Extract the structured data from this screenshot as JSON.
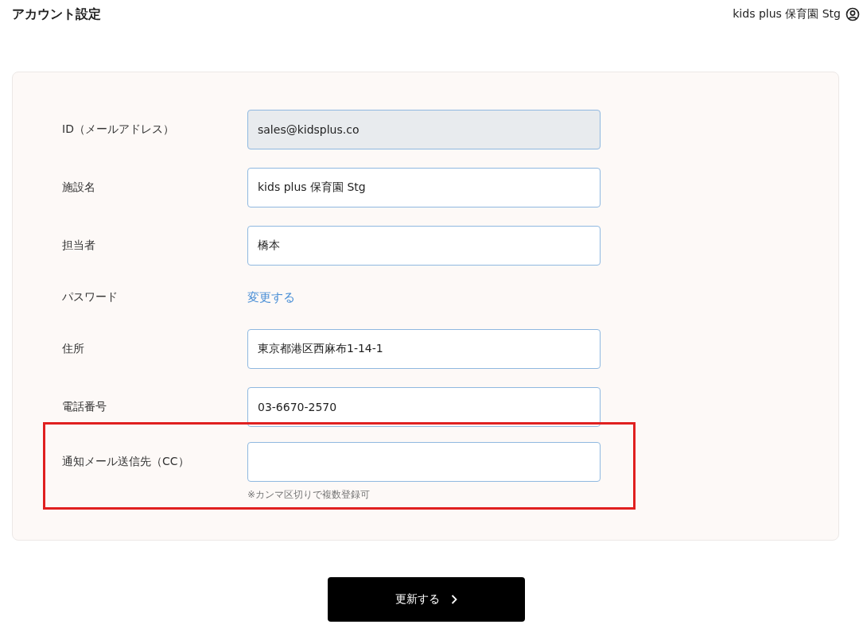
{
  "page_title": "アカウント設定",
  "user": {
    "name": "kids plus 保育園 Stg"
  },
  "form": {
    "rows": [
      {
        "kind": "input",
        "label": "ID（メールアドレス）",
        "value": "sales@kidsplus.co",
        "disabled": true,
        "highlighted": false
      },
      {
        "kind": "input",
        "label": "施設名",
        "value": "kids plus 保育園 Stg",
        "disabled": false,
        "highlighted": false
      },
      {
        "kind": "input",
        "label": "担当者",
        "value": "橋本",
        "disabled": false,
        "highlighted": false
      },
      {
        "kind": "link",
        "label": "パスワード",
        "link": "変更する",
        "highlighted": false
      },
      {
        "kind": "input",
        "label": "住所",
        "value": "東京都港区西麻布1-14-1",
        "disabled": false,
        "highlighted": false
      },
      {
        "kind": "input",
        "label": "電話番号",
        "value": "03-6670-2570",
        "disabled": false,
        "highlighted": false
      },
      {
        "kind": "input",
        "label": "通知メール送信先（CC）",
        "value": "",
        "hint": "※カンマ区切りで複数登録可",
        "disabled": false,
        "highlighted": true
      }
    ]
  },
  "submit_button": "更新する"
}
